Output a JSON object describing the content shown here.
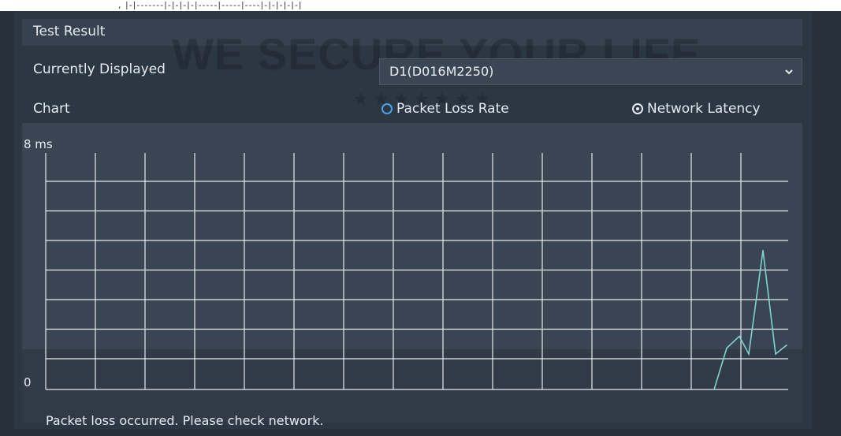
{
  "header": {
    "title": "Test Result"
  },
  "displayed": {
    "label": "Currently Displayed",
    "value": "D1(D016M2250)"
  },
  "chart_options": {
    "label": "Chart",
    "options": [
      {
        "label": "Packet Loss Rate",
        "selected": false
      },
      {
        "label": "Network Latency",
        "selected": true
      }
    ]
  },
  "watermark": {
    "text": "WE SECURE YOUR LIFE",
    "stars": "★★★★★★★"
  },
  "status": {
    "message": "Packet loss occurred. Please check network."
  },
  "colors": {
    "series": "#7fd3cf",
    "grid": "#e6ebf0",
    "selected_ring": "#4aa3e6"
  },
  "chart_data": {
    "type": "line",
    "ytop_label": "8 ms",
    "ybottom_label": "0",
    "ylim": [
      0,
      8
    ],
    "grid": true,
    "vertical_gridlines": 15,
    "horizontal_gridlines": 7,
    "x": [
      0,
      1,
      2,
      3,
      4,
      5,
      6,
      7
    ],
    "series": [
      {
        "values": [
          0,
          1.4,
          1.8,
          1.2,
          4.7,
          1.2,
          1.5
        ]
      }
    ]
  }
}
